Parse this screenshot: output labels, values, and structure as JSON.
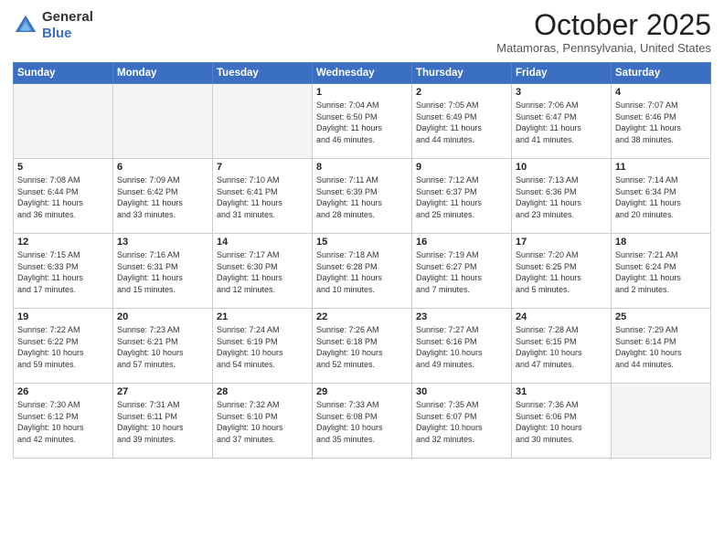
{
  "header": {
    "logo_line1": "General",
    "logo_line2": "Blue",
    "month": "October 2025",
    "location": "Matamoras, Pennsylvania, United States"
  },
  "days_of_week": [
    "Sunday",
    "Monday",
    "Tuesday",
    "Wednesday",
    "Thursday",
    "Friday",
    "Saturday"
  ],
  "weeks": [
    [
      {
        "day": "",
        "info": ""
      },
      {
        "day": "",
        "info": ""
      },
      {
        "day": "",
        "info": ""
      },
      {
        "day": "1",
        "info": "Sunrise: 7:04 AM\nSunset: 6:50 PM\nDaylight: 11 hours\nand 46 minutes."
      },
      {
        "day": "2",
        "info": "Sunrise: 7:05 AM\nSunset: 6:49 PM\nDaylight: 11 hours\nand 44 minutes."
      },
      {
        "day": "3",
        "info": "Sunrise: 7:06 AM\nSunset: 6:47 PM\nDaylight: 11 hours\nand 41 minutes."
      },
      {
        "day": "4",
        "info": "Sunrise: 7:07 AM\nSunset: 6:46 PM\nDaylight: 11 hours\nand 38 minutes."
      }
    ],
    [
      {
        "day": "5",
        "info": "Sunrise: 7:08 AM\nSunset: 6:44 PM\nDaylight: 11 hours\nand 36 minutes."
      },
      {
        "day": "6",
        "info": "Sunrise: 7:09 AM\nSunset: 6:42 PM\nDaylight: 11 hours\nand 33 minutes."
      },
      {
        "day": "7",
        "info": "Sunrise: 7:10 AM\nSunset: 6:41 PM\nDaylight: 11 hours\nand 31 minutes."
      },
      {
        "day": "8",
        "info": "Sunrise: 7:11 AM\nSunset: 6:39 PM\nDaylight: 11 hours\nand 28 minutes."
      },
      {
        "day": "9",
        "info": "Sunrise: 7:12 AM\nSunset: 6:37 PM\nDaylight: 11 hours\nand 25 minutes."
      },
      {
        "day": "10",
        "info": "Sunrise: 7:13 AM\nSunset: 6:36 PM\nDaylight: 11 hours\nand 23 minutes."
      },
      {
        "day": "11",
        "info": "Sunrise: 7:14 AM\nSunset: 6:34 PM\nDaylight: 11 hours\nand 20 minutes."
      }
    ],
    [
      {
        "day": "12",
        "info": "Sunrise: 7:15 AM\nSunset: 6:33 PM\nDaylight: 11 hours\nand 17 minutes."
      },
      {
        "day": "13",
        "info": "Sunrise: 7:16 AM\nSunset: 6:31 PM\nDaylight: 11 hours\nand 15 minutes."
      },
      {
        "day": "14",
        "info": "Sunrise: 7:17 AM\nSunset: 6:30 PM\nDaylight: 11 hours\nand 12 minutes."
      },
      {
        "day": "15",
        "info": "Sunrise: 7:18 AM\nSunset: 6:28 PM\nDaylight: 11 hours\nand 10 minutes."
      },
      {
        "day": "16",
        "info": "Sunrise: 7:19 AM\nSunset: 6:27 PM\nDaylight: 11 hours\nand 7 minutes."
      },
      {
        "day": "17",
        "info": "Sunrise: 7:20 AM\nSunset: 6:25 PM\nDaylight: 11 hours\nand 5 minutes."
      },
      {
        "day": "18",
        "info": "Sunrise: 7:21 AM\nSunset: 6:24 PM\nDaylight: 11 hours\nand 2 minutes."
      }
    ],
    [
      {
        "day": "19",
        "info": "Sunrise: 7:22 AM\nSunset: 6:22 PM\nDaylight: 10 hours\nand 59 minutes."
      },
      {
        "day": "20",
        "info": "Sunrise: 7:23 AM\nSunset: 6:21 PM\nDaylight: 10 hours\nand 57 minutes."
      },
      {
        "day": "21",
        "info": "Sunrise: 7:24 AM\nSunset: 6:19 PM\nDaylight: 10 hours\nand 54 minutes."
      },
      {
        "day": "22",
        "info": "Sunrise: 7:26 AM\nSunset: 6:18 PM\nDaylight: 10 hours\nand 52 minutes."
      },
      {
        "day": "23",
        "info": "Sunrise: 7:27 AM\nSunset: 6:16 PM\nDaylight: 10 hours\nand 49 minutes."
      },
      {
        "day": "24",
        "info": "Sunrise: 7:28 AM\nSunset: 6:15 PM\nDaylight: 10 hours\nand 47 minutes."
      },
      {
        "day": "25",
        "info": "Sunrise: 7:29 AM\nSunset: 6:14 PM\nDaylight: 10 hours\nand 44 minutes."
      }
    ],
    [
      {
        "day": "26",
        "info": "Sunrise: 7:30 AM\nSunset: 6:12 PM\nDaylight: 10 hours\nand 42 minutes."
      },
      {
        "day": "27",
        "info": "Sunrise: 7:31 AM\nSunset: 6:11 PM\nDaylight: 10 hours\nand 39 minutes."
      },
      {
        "day": "28",
        "info": "Sunrise: 7:32 AM\nSunset: 6:10 PM\nDaylight: 10 hours\nand 37 minutes."
      },
      {
        "day": "29",
        "info": "Sunrise: 7:33 AM\nSunset: 6:08 PM\nDaylight: 10 hours\nand 35 minutes."
      },
      {
        "day": "30",
        "info": "Sunrise: 7:35 AM\nSunset: 6:07 PM\nDaylight: 10 hours\nand 32 minutes."
      },
      {
        "day": "31",
        "info": "Sunrise: 7:36 AM\nSunset: 6:06 PM\nDaylight: 10 hours\nand 30 minutes."
      },
      {
        "day": "",
        "info": ""
      }
    ]
  ]
}
